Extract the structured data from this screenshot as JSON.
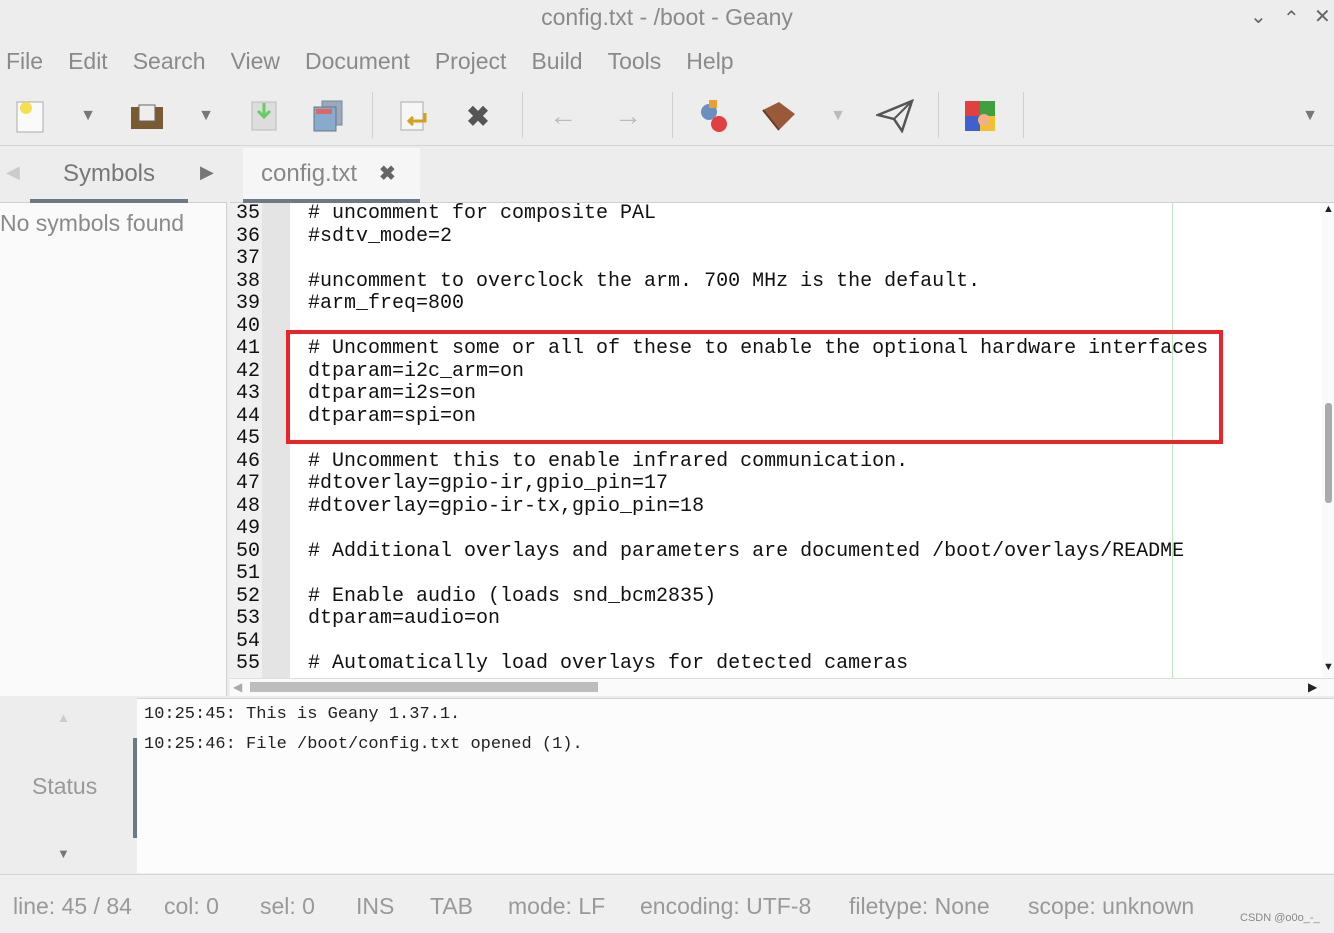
{
  "window": {
    "title": "config.txt - /boot - Geany"
  },
  "menu": [
    "File",
    "Edit",
    "Search",
    "View",
    "Document",
    "Project",
    "Build",
    "Tools",
    "Help"
  ],
  "sidebar": {
    "tab": "Symbols",
    "empty_text": "No symbols found"
  },
  "tabs": [
    {
      "label": "config.txt"
    }
  ],
  "editor": {
    "lines": [
      {
        "n": "35",
        "text": "# uncomment for composite PAL"
      },
      {
        "n": "36",
        "text": "#sdtv_mode=2"
      },
      {
        "n": "37",
        "text": ""
      },
      {
        "n": "38",
        "text": "#uncomment to overclock the arm. 700 MHz is the default."
      },
      {
        "n": "39",
        "text": "#arm_freq=800"
      },
      {
        "n": "40",
        "text": ""
      },
      {
        "n": "41",
        "text": "# Uncomment some or all of these to enable the optional hardware interfaces"
      },
      {
        "n": "42",
        "text": "dtparam=i2c_arm=on"
      },
      {
        "n": "43",
        "text": "dtparam=i2s=on"
      },
      {
        "n": "44",
        "text": "dtparam=spi=on"
      },
      {
        "n": "45",
        "text": ""
      },
      {
        "n": "46",
        "text": "# Uncomment this to enable infrared communication."
      },
      {
        "n": "47",
        "text": "#dtoverlay=gpio-ir,gpio_pin=17"
      },
      {
        "n": "48",
        "text": "#dtoverlay=gpio-ir-tx,gpio_pin=18"
      },
      {
        "n": "49",
        "text": ""
      },
      {
        "n": "50",
        "text": "# Additional overlays and parameters are documented /boot/overlays/README"
      },
      {
        "n": "51",
        "text": ""
      },
      {
        "n": "52",
        "text": "# Enable audio (loads snd_bcm2835)"
      },
      {
        "n": "53",
        "text": "dtparam=audio=on"
      },
      {
        "n": "54",
        "text": ""
      },
      {
        "n": "55",
        "text": "# Automatically load overlays for detected cameras"
      }
    ],
    "highlight_color": "#e8262a"
  },
  "messages": {
    "tab": "Status",
    "lines": [
      "10:25:45: This is Geany 1.37.1.",
      "10:25:46: File /boot/config.txt opened (1)."
    ]
  },
  "statusbar": {
    "line": "line: 45 / 84",
    "col": "col: 0",
    "sel": "sel: 0",
    "ins": "INS",
    "tab": "TAB",
    "mode": "mode: LF",
    "encoding": "encoding: UTF-8",
    "filetype": "filetype: None",
    "scope": "scope: unknown"
  },
  "watermark": "CSDN @o0o_-_"
}
